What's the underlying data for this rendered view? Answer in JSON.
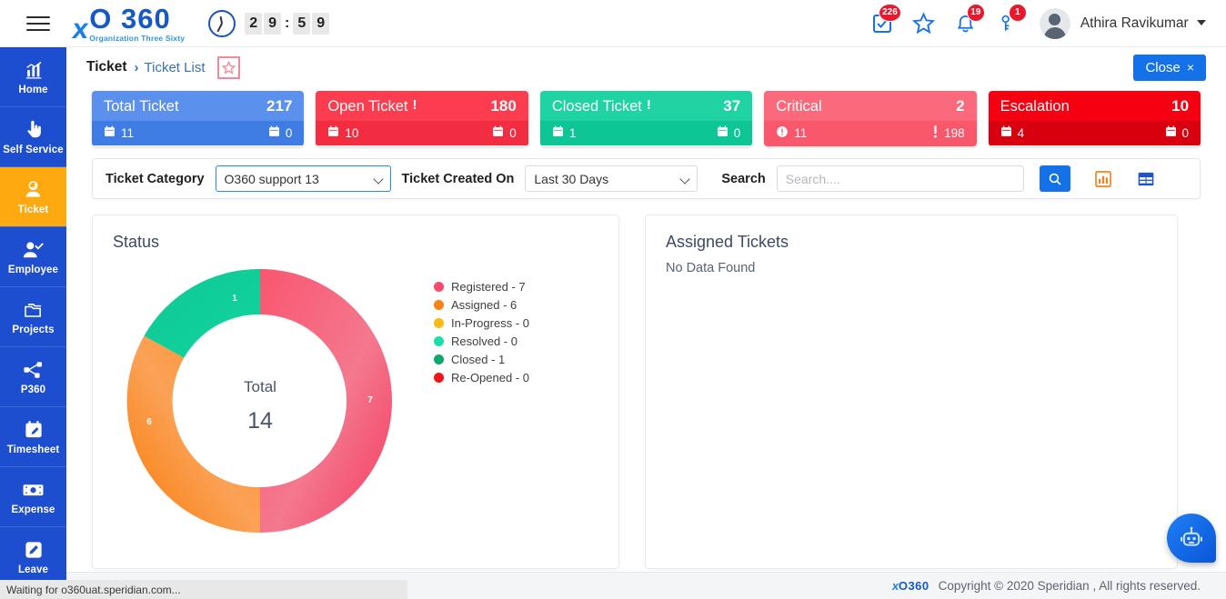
{
  "topbar": {
    "menu_icon": "hamburger-icon",
    "brand": {
      "mark": "S",
      "title": "O 360",
      "subtitle": "Organization Three Sixty"
    },
    "timer": {
      "clock_icon": "clock-icon",
      "d1": "2",
      "d2": "9",
      "colon": ":",
      "d3": "5",
      "d4": "9"
    },
    "icons": [
      {
        "name": "tasks-icon",
        "badge": "226"
      },
      {
        "name": "star-icon",
        "badge": ""
      },
      {
        "name": "bell-icon",
        "badge": "19"
      },
      {
        "name": "key-icon",
        "badge": "1"
      }
    ],
    "user": {
      "avatar": "avatar-icon",
      "name": "Athira Ravikumar",
      "caret": "chevron-down-icon"
    }
  },
  "sidebar": {
    "items": [
      {
        "label": "Home",
        "icon": "chart-bars-icon",
        "active": false
      },
      {
        "label": "Self Service",
        "icon": "hand-pointer-icon",
        "active": false
      },
      {
        "label": "Ticket",
        "icon": "headset-support-icon",
        "active": true
      },
      {
        "label": "Employee",
        "icon": "user-check-icon",
        "active": false
      },
      {
        "label": "Projects",
        "icon": "folders-icon",
        "active": false
      },
      {
        "label": "P360",
        "icon": "sitemap-icon",
        "active": false
      },
      {
        "label": "Timesheet",
        "icon": "calendar-edit-icon",
        "active": false
      },
      {
        "label": "Expense",
        "icon": "money-bill-icon",
        "active": false
      },
      {
        "label": "Leave",
        "icon": "pencil-square-icon",
        "active": false
      }
    ]
  },
  "breadcrumb": {
    "main": "Ticket",
    "separator": "›",
    "sub": "Ticket List",
    "favorite_icon": "star-outline-icon"
  },
  "close_button": {
    "label": "Close",
    "x": "×"
  },
  "cards": [
    {
      "title": "Total Ticket",
      "alert": "",
      "count": "217",
      "left_icon": "calendar-icon",
      "left_value": "11",
      "right_icon": "calendar-icon",
      "right_value": "0",
      "color": "#5b90ec"
    },
    {
      "title": "Open Ticket",
      "alert": "!",
      "count": "180",
      "left_icon": "calendar-icon",
      "left_value": "10",
      "right_icon": "calendar-icon",
      "right_value": "0",
      "color": "#fb3d4f"
    },
    {
      "title": "Closed Ticket",
      "alert": "!",
      "count": "37",
      "left_icon": "calendar-icon",
      "left_value": "1",
      "right_icon": "calendar-icon",
      "right_value": "0",
      "color": "#1fd3a3"
    },
    {
      "title": "Critical",
      "alert": "",
      "count": "2",
      "left_icon": "exclamation-circle-icon",
      "left_value": "11",
      "right_icon": "exclamation-icon",
      "right_value": "198",
      "color": "#fb6a7c"
    },
    {
      "title": "Escalation",
      "alert": "",
      "count": "10",
      "left_icon": "calendar-icon",
      "left_value": "4",
      "right_icon": "calendar-icon",
      "right_value": "0",
      "color": "#f40011"
    }
  ],
  "filters": {
    "category_label": "Ticket Category",
    "category_value": "O360 support 13",
    "created_label": "Ticket Created On",
    "created_value": "Last 30 Days",
    "search_label": "Search",
    "search_value": "",
    "search_placeholder": "Search....",
    "search_button_icon": "magnifier-icon",
    "chart_toggle_icon": "bar-chart-icon",
    "grid_toggle_icon": "grid-table-icon"
  },
  "status_panel": {
    "title": "Status"
  },
  "assigned_panel": {
    "title": "Assigned Tickets",
    "empty": "No Data Found"
  },
  "fab": {
    "icon": "chatbot-robot-icon"
  },
  "footer": {
    "logo_mark": "S",
    "logo_title": "O360",
    "copyright": "Copyright © 2020 Speridian , All rights reserved."
  },
  "browser_status": "Waiting for o360uat.speridian.com...",
  "chart_data": {
    "type": "pie",
    "title": "Status",
    "center_label": "Total",
    "center_value": "14",
    "total": 14,
    "categories": [
      "Registered",
      "Assigned",
      "In-Progress",
      "Resolved",
      "Closed",
      "Re-Opened"
    ],
    "values": [
      7,
      6,
      0,
      0,
      1,
      0
    ],
    "colors": [
      "#f64b6d",
      "#f98210",
      "#fbb914",
      "#19e0ab",
      "#0ea86f",
      "#f51414"
    ],
    "legend": [
      {
        "label": "Registered - 7",
        "color": "#f64b6d",
        "value": 7
      },
      {
        "label": "Assigned - 6",
        "color": "#f98210",
        "value": 6
      },
      {
        "label": "In-Progress - 0",
        "color": "#fbb914",
        "value": 0
      },
      {
        "label": "Resolved - 0",
        "color": "#19e0ab",
        "value": 0
      },
      {
        "label": "Closed - 1",
        "color": "#0ea86f",
        "value": 1
      },
      {
        "label": "Re-Opened - 0",
        "color": "#f51414",
        "value": 0
      }
    ],
    "legend_position": "right",
    "slice_labels": [
      "7",
      "6",
      "1"
    ],
    "donut": true
  }
}
